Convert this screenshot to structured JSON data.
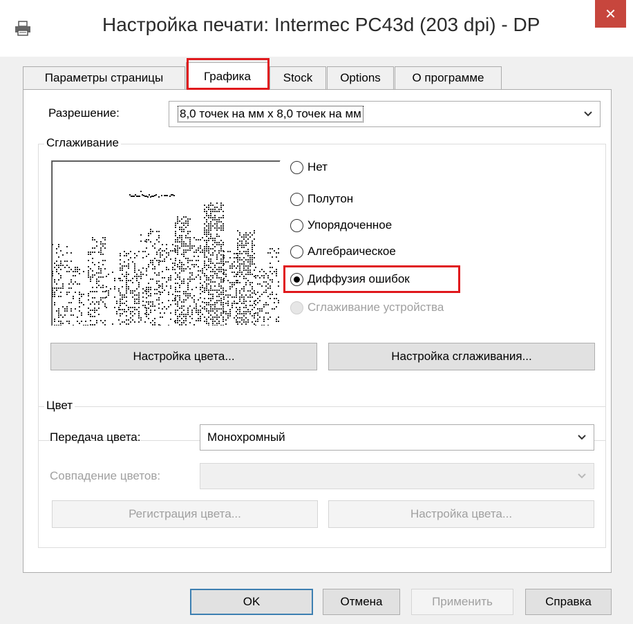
{
  "window": {
    "title": "Настройка печати: Intermec PC43d (203 dpi) - DP",
    "close_glyph": "✕"
  },
  "tabs": [
    "Параметры страницы",
    "Графика",
    "Stock",
    "Options",
    "О программе"
  ],
  "resolution": {
    "label": "Разрешение:",
    "value": "8,0 точек на мм x 8,0 точек на мм"
  },
  "dithering": {
    "group_title": "Сглаживание",
    "options": [
      "Нет",
      "Полутон",
      "Упорядоченное",
      "Алгебраическое",
      "Диффузия ошибок",
      "Сглаживание устройства"
    ],
    "selected": "Диффузия ошибок",
    "disabled": [
      "Сглаживание устройства"
    ],
    "color_setup_button": "Настройка цвета...",
    "dither_setup_button": "Настройка сглаживания..."
  },
  "color": {
    "group_title": "Цвет",
    "transfer_label": "Передача цвета:",
    "transfer_value": "Монохромный",
    "match_label": "Совпадение цветов:",
    "match_value": "",
    "register_button": "Регистрация цвета...",
    "setup_button": "Настройка цвета..."
  },
  "footer": {
    "ok": "OK",
    "cancel": "Отмена",
    "apply": "Применить",
    "help": "Справка"
  },
  "colors": {
    "highlight": "#e0181c",
    "close_button": "#c7463d",
    "default_button_border": "#3c7fb1"
  },
  "icons": {
    "window": "printer-icon",
    "close": "close-icon",
    "dropdown": "chevron-down-icon"
  }
}
